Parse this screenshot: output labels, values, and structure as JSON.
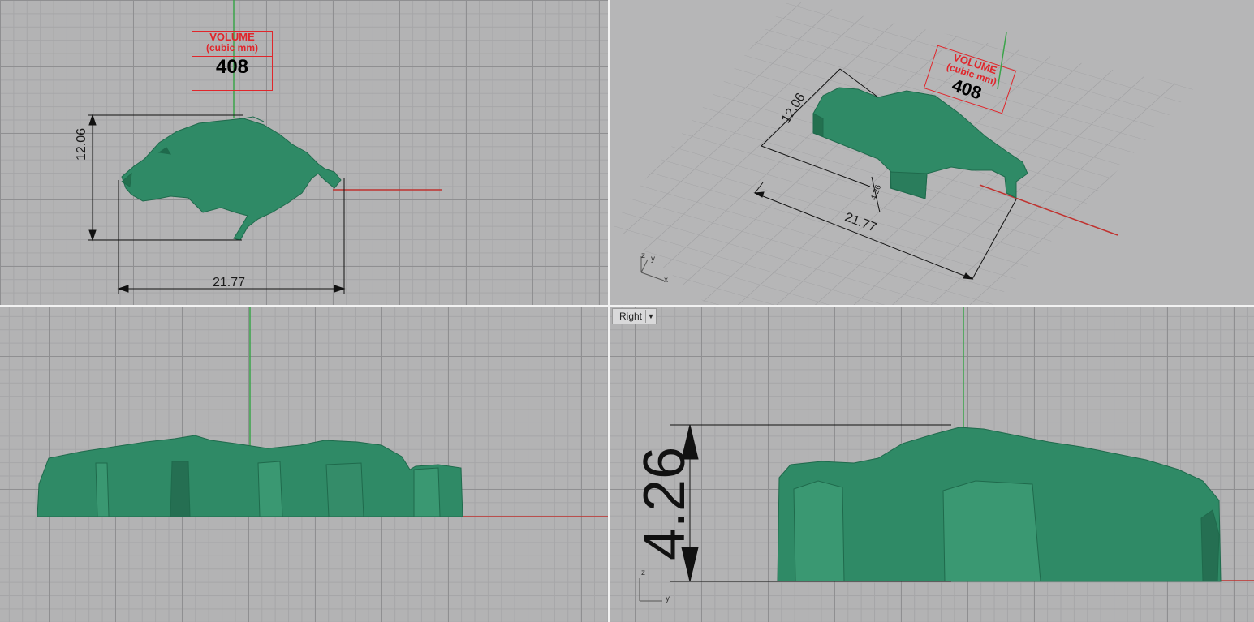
{
  "colors": {
    "model": "#2f8a66",
    "model_dark": "#1f6a4c",
    "x_axis": "#c0322f",
    "y_axis": "#3aa44a",
    "dimension": "#111111",
    "volume_label": "#e0262b"
  },
  "volume_label": {
    "line1": "VOLUME",
    "line2": "(cubic mm)",
    "value": "408"
  },
  "dimensions": {
    "height": "12.06",
    "length": "21.77",
    "depth": "4.26",
    "depth_small": "4.26"
  },
  "viewports": {
    "top": {
      "name": ""
    },
    "perspective": {
      "name": ""
    },
    "front": {
      "name": ""
    },
    "right": {
      "name": "Right",
      "dropdown_icon": "triangle-down"
    }
  },
  "axis_gizmo": {
    "x": "x",
    "y": "y",
    "z": "z"
  }
}
